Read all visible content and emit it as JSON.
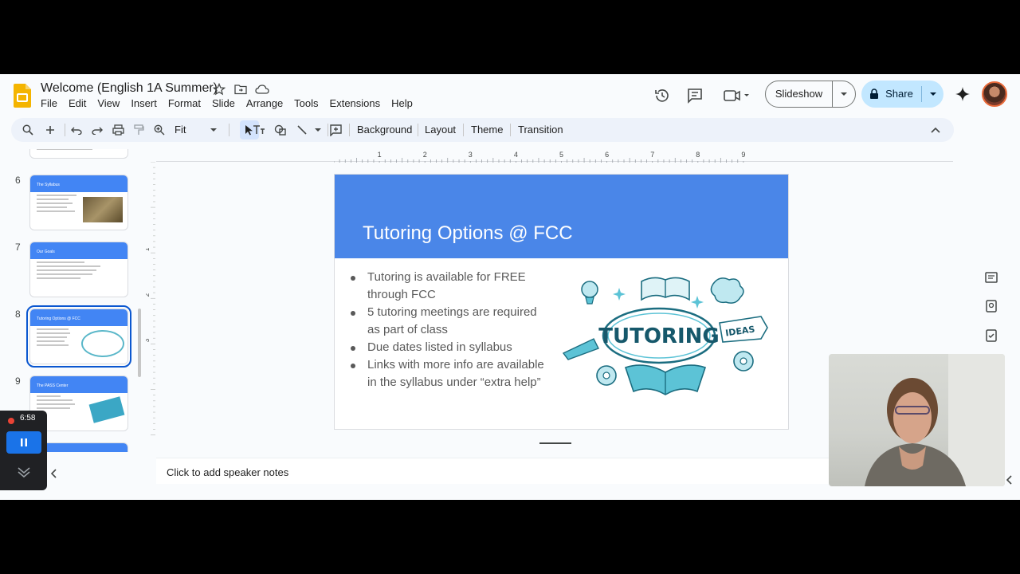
{
  "app": {
    "doc_title": "Welcome (English 1A Summer)",
    "menu": [
      "File",
      "Edit",
      "View",
      "Insert",
      "Format",
      "Slide",
      "Arrange",
      "Tools",
      "Extensions",
      "Help"
    ],
    "slideshow_label": "Slideshow",
    "share_label": "Share"
  },
  "toolbar": {
    "zoom_label": "Fit",
    "background_label": "Background",
    "layout_label": "Layout",
    "theme_label": "Theme",
    "transition_label": "Transition"
  },
  "ruler": {
    "marks": [
      "1",
      "2",
      "3",
      "4",
      "5",
      "6",
      "7",
      "8",
      "9"
    ],
    "vertical_marks": [
      "1",
      "2",
      "3"
    ]
  },
  "filmstrip": {
    "slides": [
      {
        "number": "6",
        "title": "The Syllabus"
      },
      {
        "number": "7",
        "title": "Our Goals"
      },
      {
        "number": "8",
        "title": "Tutoring Options @ FCC"
      },
      {
        "number": "9",
        "title": "The PASS Center"
      }
    ],
    "selected": "8"
  },
  "slide": {
    "title": "Tutoring Options @ FCC",
    "bullets": [
      "Tutoring is available for FREE through FCC",
      "5 tutoring meetings are required as part of class",
      "Due dates listed in syllabus",
      "Links with more info are available in the syllabus under “extra help”"
    ],
    "image_text": {
      "main": "TUTORING",
      "banner": "IDEAS"
    }
  },
  "notes": {
    "placeholder": "Click to add speaker notes"
  },
  "recorder": {
    "time": "6:58"
  },
  "colors": {
    "header_blue": "#4a86e8",
    "share_bg": "#c2e7ff",
    "accent": "#0b57d0"
  }
}
